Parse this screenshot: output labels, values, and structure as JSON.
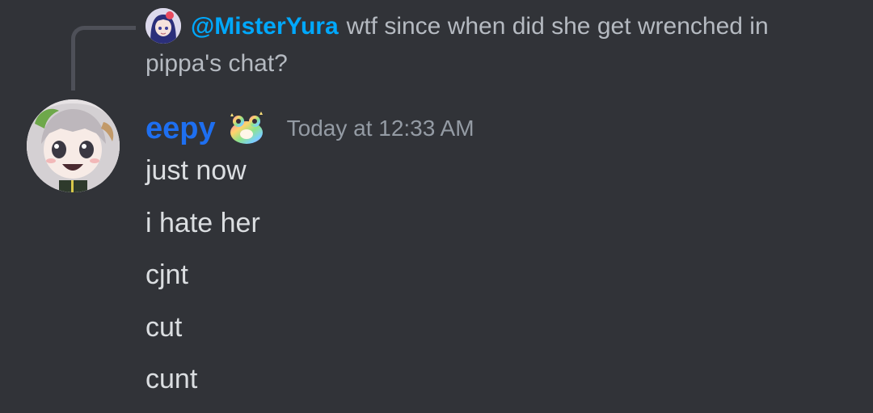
{
  "reply": {
    "mention": "@MisterYura",
    "text": "wtf since when did she get wrenched in pippa's chat?"
  },
  "message": {
    "username": "eepy",
    "badge": "rainbow-frog-icon",
    "timestamp": "Today at 12:33 AM",
    "lines": [
      "just now",
      "i hate her",
      "cjnt",
      "cut",
      "cunt"
    ]
  },
  "colors": {
    "background": "#313338",
    "mention": "#00a8fc",
    "username": "#1e6ff0",
    "timestamp": "#949ba4",
    "text": "#dbdee1"
  }
}
